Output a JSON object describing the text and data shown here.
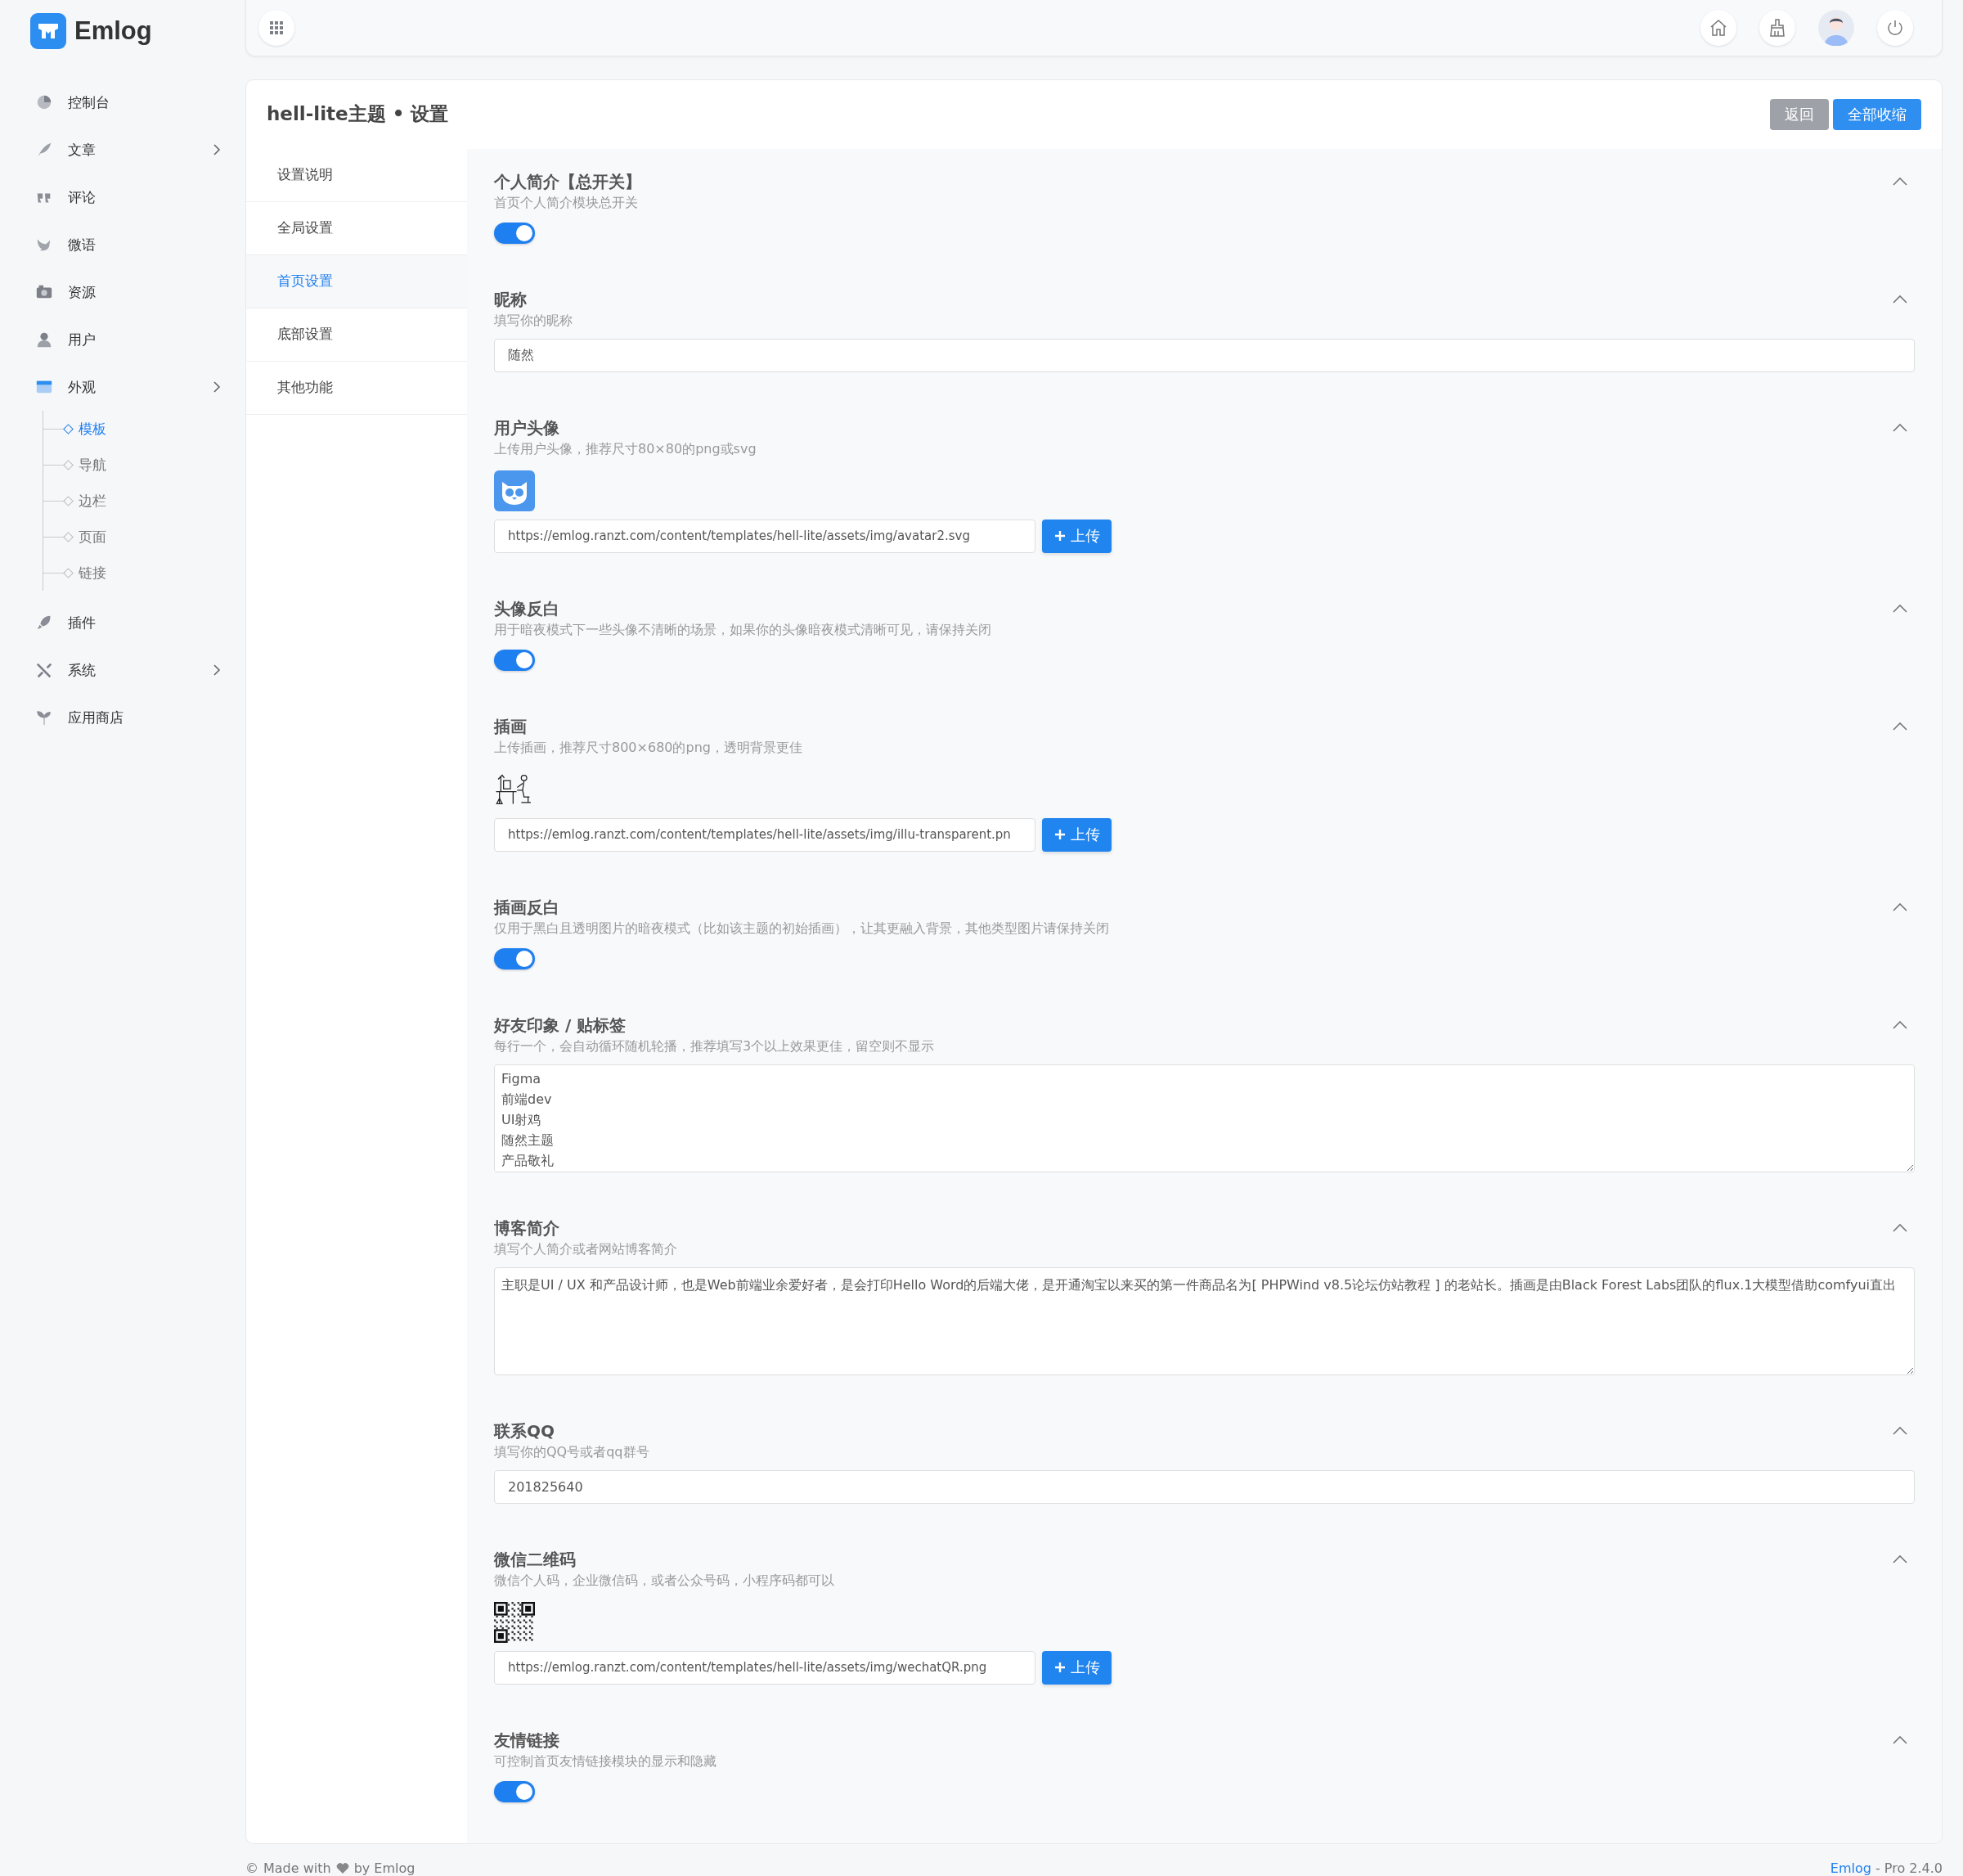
{
  "brand": {
    "name": "Emlog"
  },
  "nav": [
    {
      "kind": "link",
      "label": "控制台"
    },
    {
      "kind": "group",
      "label": "文章"
    },
    {
      "kind": "link",
      "label": "评论"
    },
    {
      "kind": "link",
      "label": "微语"
    },
    {
      "kind": "link",
      "label": "资源"
    },
    {
      "kind": "link",
      "label": "用户"
    },
    {
      "kind": "group",
      "label": "外观",
      "children": [
        {
          "label": "模板",
          "selected": true
        },
        {
          "label": "导航",
          "selected": false
        },
        {
          "label": "边栏",
          "selected": false
        },
        {
          "label": "页面",
          "selected": false
        },
        {
          "label": "链接",
          "selected": false
        }
      ]
    },
    {
      "kind": "link",
      "label": "插件"
    },
    {
      "kind": "group",
      "label": "系统"
    },
    {
      "kind": "link",
      "label": "应用商店"
    }
  ],
  "page": {
    "title": "hell-lite主题 • 设置",
    "buttons": [
      {
        "label": "返回",
        "kind": "secondary"
      },
      {
        "label": "全部收缩",
        "kind": "primary"
      }
    ]
  },
  "tabs": [
    {
      "label": "设置说明",
      "selected": false
    },
    {
      "label": "全局设置",
      "selected": false
    },
    {
      "label": "首页设置",
      "selected": true
    },
    {
      "label": "底部设置",
      "selected": false
    },
    {
      "label": "其他功能",
      "selected": false
    }
  ],
  "sections": [
    {
      "kind": "toggle",
      "title": "个人简介【总开关】",
      "description": "首页个人简介模块总开关",
      "expanded": true,
      "on": true
    },
    {
      "kind": "text",
      "title": "昵称",
      "description": "填写你的昵称",
      "expanded": true,
      "value": "随然"
    },
    {
      "kind": "avatar_upload",
      "title": "用户头像",
      "description": "上传用户头像，推荐尺寸80×80的png或svg",
      "expanded": true,
      "value": "https://emlog.ranzt.com/content/templates/hell-lite/assets/img/avatar2.svg",
      "button": "上传"
    },
    {
      "kind": "toggle",
      "title": "头像反白",
      "description": "用于暗夜模式下一些头像不清晰的场景，如果你的头像暗夜模式清晰可见，请保持关闭",
      "expanded": true,
      "on": true
    },
    {
      "kind": "illustration_upload",
      "title": "插画",
      "description": "上传插画，推荐尺寸800×680的png，透明背景更佳",
      "expanded": true,
      "value": "https://emlog.ranzt.com/content/templates/hell-lite/assets/img/illu-transparent.pn",
      "button": "上传"
    },
    {
      "kind": "toggle",
      "title": "插画反白",
      "description": "仅用于黑白且透明图片的暗夜模式（比如该主题的初始插画），让其更融入背景，其他类型图片请保持关闭",
      "expanded": true,
      "on": true
    },
    {
      "kind": "textarea",
      "title": "好友印象 / 贴标签",
      "description": "每行一个，会自动循环随机轮播，推荐填写3个以上效果更佳，留空则不显示",
      "expanded": true,
      "lines": [
        "Figma",
        "前端dev",
        "UI射鸡",
        "随然主题",
        "产品敬礼"
      ]
    },
    {
      "kind": "textarea",
      "title": "博客简介",
      "description": "填写个人简介或者网站博客简介",
      "expanded": true,
      "lines": [
        "主职是UI / UX 和产品设计师，也是Web前端业余爱好者，是会打印Hello Word的后端大佬，是开通淘宝以来买的第一件商品名为[ PHPWind v8.5论坛仿站教程 ] 的老站长。插画是由Black Forest Labs团队的flux.1大模型借助comfyui直出"
      ]
    },
    {
      "kind": "text",
      "title": "联系QQ",
      "description": "填写你的QQ号或者qq群号",
      "expanded": true,
      "value": "201825640"
    },
    {
      "kind": "qr_upload",
      "title": "微信二维码",
      "description": "微信个人码，企业微信码，或者公众号码，小程序码都可以",
      "expanded": true,
      "value": "https://emlog.ranzt.com/content/templates/hell-lite/assets/img/wechatQR.png",
      "button": "上传"
    },
    {
      "kind": "toggle",
      "title": "友情链接",
      "description": "可控制首页友情链接模块的显示和隐藏",
      "expanded": true,
      "on": true
    }
  ],
  "footer": {
    "copyright": "©",
    "made_with": "Made with",
    "by": "by Emlog",
    "link": "Emlog",
    "version": "- Pro 2.4.0"
  }
}
